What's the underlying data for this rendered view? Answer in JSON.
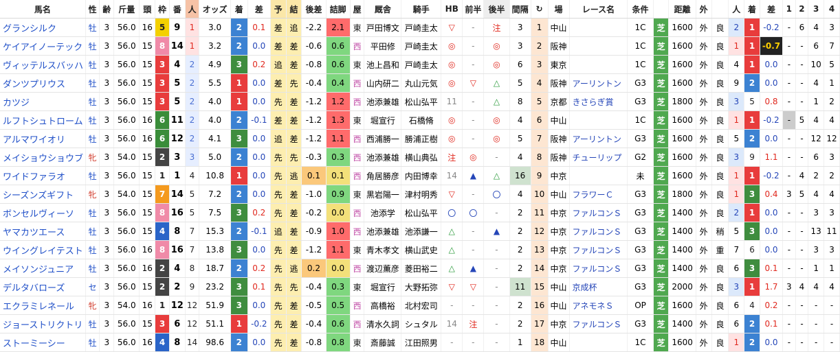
{
  "headers": [
    "馬名",
    "性",
    "齢",
    "斤量",
    "頭",
    "枠",
    "番",
    "人",
    "オッズ",
    "着",
    "差",
    "予",
    "結",
    "後差",
    "詰脚",
    "屋",
    "厩舎",
    "騎手",
    "HB",
    "前半",
    "後半",
    "間隔",
    "↻",
    "場",
    "レース名",
    "条件",
    "",
    "距離",
    "外",
    "",
    "人",
    "着",
    "差",
    "1",
    "2",
    "3",
    "4"
  ],
  "frame_colors": {
    "1": "#ffffff",
    "2": "#444444",
    "3": "#e83c3c",
    "4": "#2a64c8",
    "5": "#f4d000",
    "6": "#3a8d3a",
    "7": "#f49a1e",
    "8": "#f08aa8"
  },
  "rows": [
    {
      "name": "グランシルク",
      "sex": "牡",
      "age": "3",
      "kin": "56.0",
      "tou": "16",
      "waku": "5",
      "ban": "9",
      "pop": "1",
      "odds": "3.0",
      "chaku": "2",
      "sa": "0.1",
      "yo": "差",
      "ket": "追",
      "kosa": "-2.2",
      "tsume": "2.1",
      "ya": "東",
      "kyu": "戸田博文",
      "jockey": "戸崎圭太",
      "hb": "▽",
      "zen": "-",
      "kou": "注",
      "kan": "3",
      "loop": "1",
      "ba": "中山",
      "race": "",
      "jou": "1C",
      "shiba": "芝",
      "kyori": "1600",
      "soto": "外",
      "baba": "良",
      "p_pop": "2",
      "p_chaku": "1",
      "p_sa": "-0.2",
      "p1": "-",
      "p2": "6",
      "p3": "4",
      "p4": "3"
    },
    {
      "name": "ケイアイノーテック",
      "sex": "牡",
      "age": "3",
      "kin": "56.0",
      "tou": "15",
      "waku": "8",
      "ban": "14",
      "pop": "1",
      "odds": "3.2",
      "chaku": "2",
      "sa": "0.0",
      "yo": "差",
      "ket": "差",
      "kosa": "-0.6",
      "tsume": "0.6",
      "ya": "西",
      "kyu": "平田修",
      "jockey": "戸崎圭太",
      "hb": "◎",
      "zen": "-",
      "kou": "◎",
      "kan": "3",
      "loop": "2",
      "ba": "阪神",
      "race": "",
      "jou": "1C",
      "shiba": "芝",
      "kyori": "1600",
      "soto": "外",
      "baba": "良",
      "p_pop": "1",
      "p_chaku": "1",
      "p_sa": "-0.7",
      "p1": "-",
      "p2": "-",
      "p3": "6",
      "p4": "7"
    },
    {
      "name": "ヴィッテルスバッハ",
      "sex": "牡",
      "age": "3",
      "kin": "56.0",
      "tou": "15",
      "waku": "3",
      "ban": "4",
      "pop": "2",
      "odds": "4.9",
      "chaku": "3",
      "sa": "0.2",
      "yo": "追",
      "ket": "差",
      "kosa": "-0.8",
      "tsume": "0.6",
      "ya": "東",
      "kyu": "池上昌和",
      "jockey": "戸崎圭太",
      "hb": "◎",
      "zen": "-",
      "kou": "◎",
      "kan": "6",
      "loop": "3",
      "ba": "東京",
      "race": "",
      "jou": "1C",
      "shiba": "芝",
      "kyori": "1600",
      "soto": "外",
      "baba": "良",
      "p_pop": "4",
      "p_chaku": "1",
      "p_sa": "0.0",
      "p1": "-",
      "p2": "-",
      "p3": "10",
      "p4": "5"
    },
    {
      "name": "ダンツプリウス",
      "sex": "牡",
      "age": "3",
      "kin": "56.0",
      "tou": "15",
      "waku": "3",
      "ban": "5",
      "pop": "2",
      "odds": "5.5",
      "chaku": "1",
      "sa": "0.0",
      "yo": "差",
      "ket": "先",
      "kosa": "-0.4",
      "tsume": "0.4",
      "ya": "西",
      "kyu": "山内研二",
      "jockey": "丸山元気",
      "hb": "◎",
      "zen": "▽",
      "kou": "△",
      "kan": "5",
      "loop": "4",
      "ba": "阪神",
      "race": "アーリントン",
      "jou": "G3",
      "shiba": "芝",
      "kyori": "1600",
      "soto": "外",
      "baba": "良",
      "p_pop": "9",
      "p_chaku": "2",
      "p_sa": "0.0",
      "p1": "-",
      "p2": "-",
      "p3": "4",
      "p4": "1"
    },
    {
      "name": "カツジ",
      "sex": "牡",
      "age": "3",
      "kin": "56.0",
      "tou": "15",
      "waku": "3",
      "ban": "5",
      "pop": "2",
      "odds": "4.0",
      "chaku": "1",
      "sa": "0.0",
      "yo": "先",
      "ket": "差",
      "kosa": "-1.2",
      "tsume": "1.2",
      "ya": "西",
      "kyu": "池添兼雄",
      "jockey": "松山弘平",
      "hb": "11",
      "zen": "-",
      "kou": "△",
      "kan": "8",
      "loop": "5",
      "ba": "京都",
      "race": "きさらぎ賞",
      "jou": "G3",
      "shiba": "芝",
      "kyori": "1800",
      "soto": "外",
      "baba": "良",
      "p_pop": "3",
      "p_chaku": "5",
      "p_sa": "0.8",
      "p1": "-",
      "p2": "-",
      "p3": "1",
      "p4": "2"
    },
    {
      "name": "ルフトシュトローム",
      "sex": "牡",
      "age": "3",
      "kin": "56.0",
      "tou": "16",
      "waku": "6",
      "ban": "11",
      "pop": "2",
      "odds": "4.0",
      "chaku": "2",
      "sa": "-0.1",
      "yo": "差",
      "ket": "差",
      "kosa": "-1.2",
      "tsume": "1.3",
      "ya": "東",
      "kyu": "堀宣行",
      "jockey": "石橋脩",
      "hb": "◎",
      "zen": "-",
      "kou": "◎",
      "kan": "4",
      "loop": "6",
      "ba": "中山",
      "race": "",
      "jou": "1C",
      "shiba": "芝",
      "kyori": "1600",
      "soto": "外",
      "baba": "良",
      "p_pop": "1",
      "p_chaku": "1",
      "p_sa": "-0.2",
      "p1": "-",
      "p2": "5",
      "p3": "4",
      "p4": "4"
    },
    {
      "name": "アルマワイオリ",
      "sex": "牡",
      "age": "3",
      "kin": "56.0",
      "tou": "16",
      "waku": "6",
      "ban": "12",
      "pop": "2",
      "odds": "4.1",
      "chaku": "3",
      "sa": "0.0",
      "yo": "追",
      "ket": "差",
      "kosa": "-1.2",
      "tsume": "1.1",
      "ya": "西",
      "kyu": "西浦勝一",
      "jockey": "勝浦正樹",
      "hb": "◎",
      "zen": "-",
      "kou": "◎",
      "kan": "5",
      "loop": "7",
      "ba": "阪神",
      "race": "アーリントン",
      "jou": "G3",
      "shiba": "芝",
      "kyori": "1600",
      "soto": "外",
      "baba": "良",
      "p_pop": "5",
      "p_chaku": "2",
      "p_sa": "0.0",
      "p1": "-",
      "p2": "-",
      "p3": "12",
      "p4": "12"
    },
    {
      "name": "メイショウショウブ",
      "sex": "牝",
      "age": "3",
      "kin": "54.0",
      "tou": "15",
      "waku": "2",
      "ban": "3",
      "pop": "3",
      "odds": "5.0",
      "chaku": "2",
      "sa": "0.0",
      "yo": "先",
      "ket": "先",
      "kosa": "-0.3",
      "tsume": "0.3",
      "ya": "西",
      "kyu": "池添兼雄",
      "jockey": "横山典弘",
      "hb": "注",
      "zen": "◎",
      "kou": "-",
      "kan": "4",
      "loop": "8",
      "ba": "阪神",
      "race": "チューリップ",
      "jou": "G2",
      "shiba": "芝",
      "kyori": "1600",
      "soto": "外",
      "baba": "良",
      "p_pop": "3",
      "p_chaku": "9",
      "p_sa": "1.1",
      "p1": "-",
      "p2": "-",
      "p3": "6",
      "p4": "3"
    },
    {
      "name": "ワイドファラオ",
      "sex": "牡",
      "age": "3",
      "kin": "56.0",
      "tou": "15",
      "waku": "1",
      "ban": "1",
      "pop": "4",
      "odds": "10.8",
      "chaku": "1",
      "sa": "0.0",
      "yo": "先",
      "ket": "逃",
      "kosa": "0.1",
      "tsume": "0.1",
      "ya": "西",
      "kyu": "角居勝彦",
      "jockey": "内田博幸",
      "hb": "14",
      "zen": "▲",
      "kou": "△",
      "kan": "16",
      "loop": "9",
      "ba": "中京",
      "race": "",
      "jou": "未",
      "shiba": "芝",
      "kyori": "1600",
      "soto": "外",
      "baba": "良",
      "p_pop": "1",
      "p_chaku": "1",
      "p_sa": "-0.2",
      "p1": "-",
      "p2": "4",
      "p3": "2",
      "p4": "2"
    },
    {
      "name": "シーズンズギフト",
      "sex": "牝",
      "age": "3",
      "kin": "54.0",
      "tou": "15",
      "waku": "7",
      "ban": "14",
      "pop": "5",
      "odds": "7.2",
      "chaku": "2",
      "sa": "0.0",
      "yo": "先",
      "ket": "差",
      "kosa": "-1.0",
      "tsume": "0.9",
      "ya": "東",
      "kyu": "黒岩陽一",
      "jockey": "津村明秀",
      "hb": "▽",
      "zen": "-",
      "kou": "〇",
      "kan": "4",
      "loop": "10",
      "ba": "中山",
      "race": "フラワーＣ",
      "jou": "G3",
      "shiba": "芝",
      "kyori": "1800",
      "soto": "外",
      "baba": "良",
      "p_pop": "1",
      "p_chaku": "3",
      "p_sa": "0.4",
      "p1": "3",
      "p2": "5",
      "p3": "4",
      "p4": "4"
    },
    {
      "name": "ボンセルヴィーソ",
      "sex": "牡",
      "age": "3",
      "kin": "56.0",
      "tou": "15",
      "waku": "8",
      "ban": "16",
      "pop": "5",
      "odds": "7.5",
      "chaku": "3",
      "sa": "0.2",
      "yo": "先",
      "ket": "差",
      "kosa": "-0.2",
      "tsume": "0.0",
      "ya": "西",
      "kyu": "池添学",
      "jockey": "松山弘平",
      "hb": "〇",
      "zen": "〇",
      "kou": "-",
      "kan": "2",
      "loop": "11",
      "ba": "中京",
      "race": "ファルコンＳ",
      "jou": "G3",
      "shiba": "芝",
      "kyori": "1400",
      "soto": "外",
      "baba": "良",
      "p_pop": "2",
      "p_chaku": "1",
      "p_sa": "0.0",
      "p1": "-",
      "p2": "-",
      "p3": "3",
      "p4": "3"
    },
    {
      "name": "ヤマカツエース",
      "sex": "牡",
      "age": "3",
      "kin": "56.0",
      "tou": "15",
      "waku": "4",
      "ban": "8",
      "pop": "7",
      "odds": "15.3",
      "chaku": "2",
      "sa": "-0.1",
      "yo": "追",
      "ket": "差",
      "kosa": "-0.9",
      "tsume": "1.0",
      "ya": "西",
      "kyu": "池添兼雄",
      "jockey": "池添謙一",
      "hb": "△",
      "zen": "-",
      "kou": "▲",
      "kan": "2",
      "loop": "12",
      "ba": "中京",
      "race": "ファルコンＳ",
      "jou": "G3",
      "shiba": "芝",
      "kyori": "1400",
      "soto": "外",
      "baba": "稍",
      "p_pop": "5",
      "p_chaku": "3",
      "p_sa": "0.0",
      "p1": "-",
      "p2": "-",
      "p3": "13",
      "p4": "11"
    },
    {
      "name": "ウイングレイテスト",
      "sex": "牡",
      "age": "3",
      "kin": "56.0",
      "tou": "16",
      "waku": "8",
      "ban": "16",
      "pop": "7",
      "odds": "13.8",
      "chaku": "3",
      "sa": "0.0",
      "yo": "先",
      "ket": "差",
      "kosa": "-1.2",
      "tsume": "1.1",
      "ya": "東",
      "kyu": "青木孝文",
      "jockey": "横山武史",
      "hb": "△",
      "zen": "-",
      "kou": "-",
      "kan": "2",
      "loop": "13",
      "ba": "中京",
      "race": "ファルコンＳ",
      "jou": "G3",
      "shiba": "芝",
      "kyori": "1400",
      "soto": "外",
      "baba": "重",
      "p_pop": "7",
      "p_chaku": "6",
      "p_sa": "0.0",
      "p1": "-",
      "p2": "-",
      "p3": "3",
      "p4": "3"
    },
    {
      "name": "メイソンジュニア",
      "sex": "牡",
      "age": "3",
      "kin": "56.0",
      "tou": "16",
      "waku": "2",
      "ban": "4",
      "pop": "8",
      "odds": "18.7",
      "chaku": "2",
      "sa": "0.2",
      "yo": "先",
      "ket": "逃",
      "kosa": "0.2",
      "tsume": "0.0",
      "ya": "西",
      "kyu": "渡辺薫彦",
      "jockey": "菱田裕二",
      "hb": "△",
      "zen": "▲",
      "kou": "-",
      "kan": "2",
      "loop": "14",
      "ba": "中京",
      "race": "ファルコンＳ",
      "jou": "G3",
      "shiba": "芝",
      "kyori": "1400",
      "soto": "外",
      "baba": "良",
      "p_pop": "6",
      "p_chaku": "3",
      "p_sa": "0.1",
      "p1": "-",
      "p2": "-",
      "p3": "1",
      "p4": "1"
    },
    {
      "name": "デルタバローズ",
      "sex": "セ",
      "age": "3",
      "kin": "56.0",
      "tou": "15",
      "waku": "2",
      "ban": "2",
      "pop": "9",
      "odds": "23.2",
      "chaku": "3",
      "sa": "0.1",
      "yo": "先",
      "ket": "先",
      "kosa": "-0.4",
      "tsume": "0.3",
      "ya": "東",
      "kyu": "堀宣行",
      "jockey": "大野拓弥",
      "hb": "▽",
      "zen": "▽",
      "kou": "-",
      "kan": "11",
      "loop": "15",
      "ba": "中山",
      "race": "京成杯",
      "jou": "G3",
      "shiba": "芝",
      "kyori": "2000",
      "soto": "外",
      "baba": "良",
      "p_pop": "3",
      "p_chaku": "1",
      "p_sa": "1.7",
      "p1": "3",
      "p2": "4",
      "p3": "4",
      "p4": "4"
    },
    {
      "name": "エクラミレネール",
      "sex": "牝",
      "age": "3",
      "kin": "54.0",
      "tou": "16",
      "waku": "1",
      "ban": "12",
      "pop": "12",
      "odds": "51.9",
      "chaku": "3",
      "sa": "0.0",
      "yo": "先",
      "ket": "差",
      "kosa": "-0.5",
      "tsume": "0.5",
      "ya": "西",
      "kyu": "高橋裕",
      "jockey": "北村宏司",
      "hb": "-",
      "zen": "-",
      "kou": "-",
      "kan": "2",
      "loop": "16",
      "ba": "中山",
      "race": "アネモネＳ",
      "jou": "OP",
      "shiba": "芝",
      "kyori": "1600",
      "soto": "外",
      "baba": "良",
      "p_pop": "6",
      "p_chaku": "4",
      "p_sa": "0.2",
      "p1": "-",
      "p2": "-",
      "p3": "-",
      "p4": "-"
    },
    {
      "name": "ジョーストリクトリ",
      "sex": "牡",
      "age": "3",
      "kin": "56.0",
      "tou": "15",
      "waku": "3",
      "ban": "6",
      "pop": "12",
      "odds": "51.1",
      "chaku": "1",
      "sa": "-0.2",
      "yo": "先",
      "ket": "差",
      "kosa": "-0.4",
      "tsume": "0.6",
      "ya": "西",
      "kyu": "清水久詞",
      "jockey": "シュタル",
      "hb": "14",
      "zen": "注",
      "kou": "-",
      "kan": "2",
      "loop": "17",
      "ba": "中京",
      "race": "ファルコンＳ",
      "jou": "G3",
      "shiba": "芝",
      "kyori": "1400",
      "soto": "外",
      "baba": "良",
      "p_pop": "6",
      "p_chaku": "2",
      "p_sa": "0.1",
      "p1": "-",
      "p2": "-",
      "p3": "-",
      "p4": "-"
    },
    {
      "name": "ストーミーシー",
      "sex": "牡",
      "age": "3",
      "kin": "56.0",
      "tou": "16",
      "waku": "4",
      "ban": "8",
      "pop": "14",
      "odds": "98.6",
      "chaku": "2",
      "sa": "0.0",
      "yo": "先",
      "ket": "差",
      "kosa": "-0.8",
      "tsume": "0.8",
      "ya": "東",
      "kyu": "斎藤誠",
      "jockey": "江田照男",
      "hb": "-",
      "zen": "-",
      "kou": "-",
      "kan": "1",
      "loop": "18",
      "ba": "中山",
      "race": "",
      "jou": "1C",
      "shiba": "芝",
      "kyori": "1600",
      "soto": "外",
      "baba": "良",
      "p_pop": "1",
      "p_chaku": "2",
      "p_sa": "0.0",
      "p1": "-",
      "p2": "-",
      "p3": "-",
      "p4": "-"
    }
  ]
}
